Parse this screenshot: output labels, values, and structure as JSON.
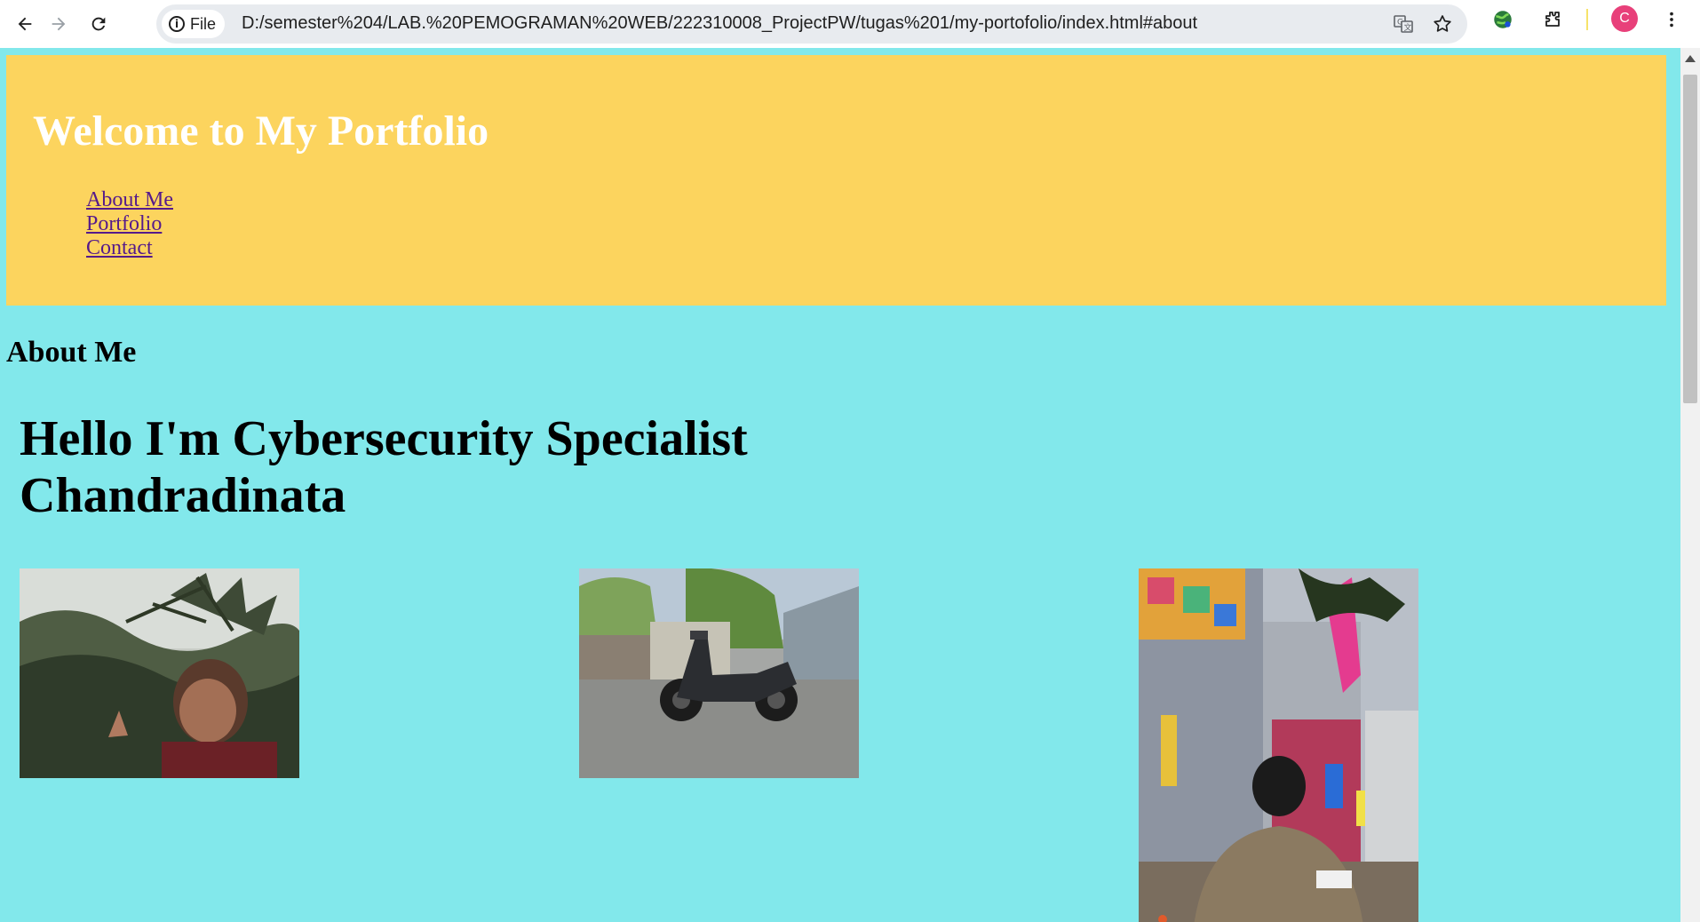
{
  "browser": {
    "site_chip_label": "File",
    "url": "D:/semester%204/LAB.%20PEMOGRAMAN%20WEB/222310008_ProjectPW/tugas%201/my-portofolio/index.html#about",
    "profile_initial": "C",
    "icons": [
      "back-icon",
      "forward-icon",
      "reload-icon",
      "info-icon",
      "translate-icon",
      "star-icon",
      "extension-globe-icon",
      "puzzle-icon",
      "kebab-menu-icon"
    ]
  },
  "header": {
    "title": "Welcome to My Portfolio",
    "nav": [
      {
        "label": "About Me"
      },
      {
        "label": "Portfolio"
      },
      {
        "label": "Contact"
      }
    ]
  },
  "about": {
    "heading": "About Me",
    "hello_line1": "Hello I'm Cybersecurity Specialist",
    "hello_line2": "Chandradinata"
  },
  "colors": {
    "page_background": "#82e8eb",
    "header_background": "#fcd45e",
    "title_color": "#ffffff",
    "link_color": "#551a8b"
  }
}
